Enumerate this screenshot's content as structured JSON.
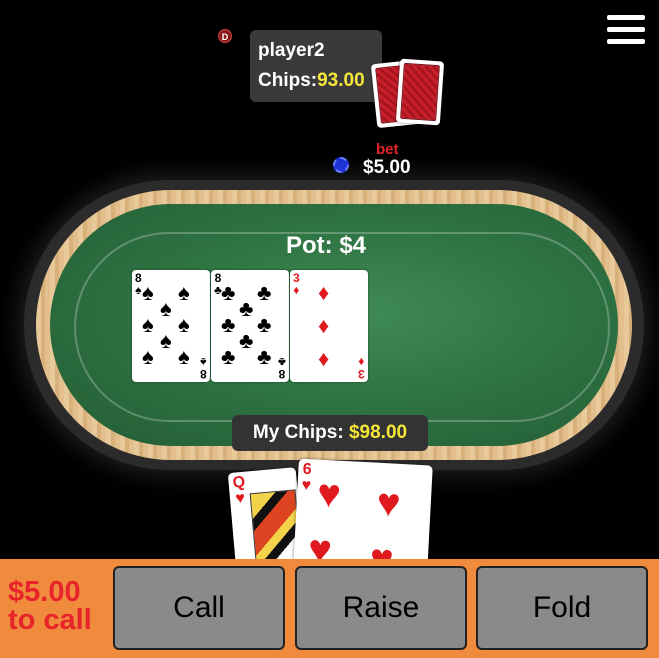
{
  "menu": {
    "icon": "hamburger-menu-icon"
  },
  "dealer": {
    "label": "D"
  },
  "opponent": {
    "name": "player2",
    "chips_label": "Chips:",
    "chips_value": "93.00"
  },
  "bet": {
    "label": "bet",
    "amount": "$5.00"
  },
  "pot": {
    "label": "Pot: $4"
  },
  "board": [
    {
      "rank": "8",
      "suit": "♠",
      "color": "#000000"
    },
    {
      "rank": "8",
      "suit": "♣",
      "color": "#000000"
    },
    {
      "rank": "3",
      "suit": "♦",
      "color": "#e0191e"
    }
  ],
  "my_chips": {
    "label": "My Chips:",
    "value": "$98.00"
  },
  "hand": [
    {
      "rank": "Q",
      "suit": "♥"
    },
    {
      "rank": "6",
      "suit": "♥"
    }
  ],
  "actions": {
    "to_call_amount": "$5.00",
    "to_call_text": "to call",
    "call": "Call",
    "raise": "Raise",
    "fold": "Fold"
  }
}
